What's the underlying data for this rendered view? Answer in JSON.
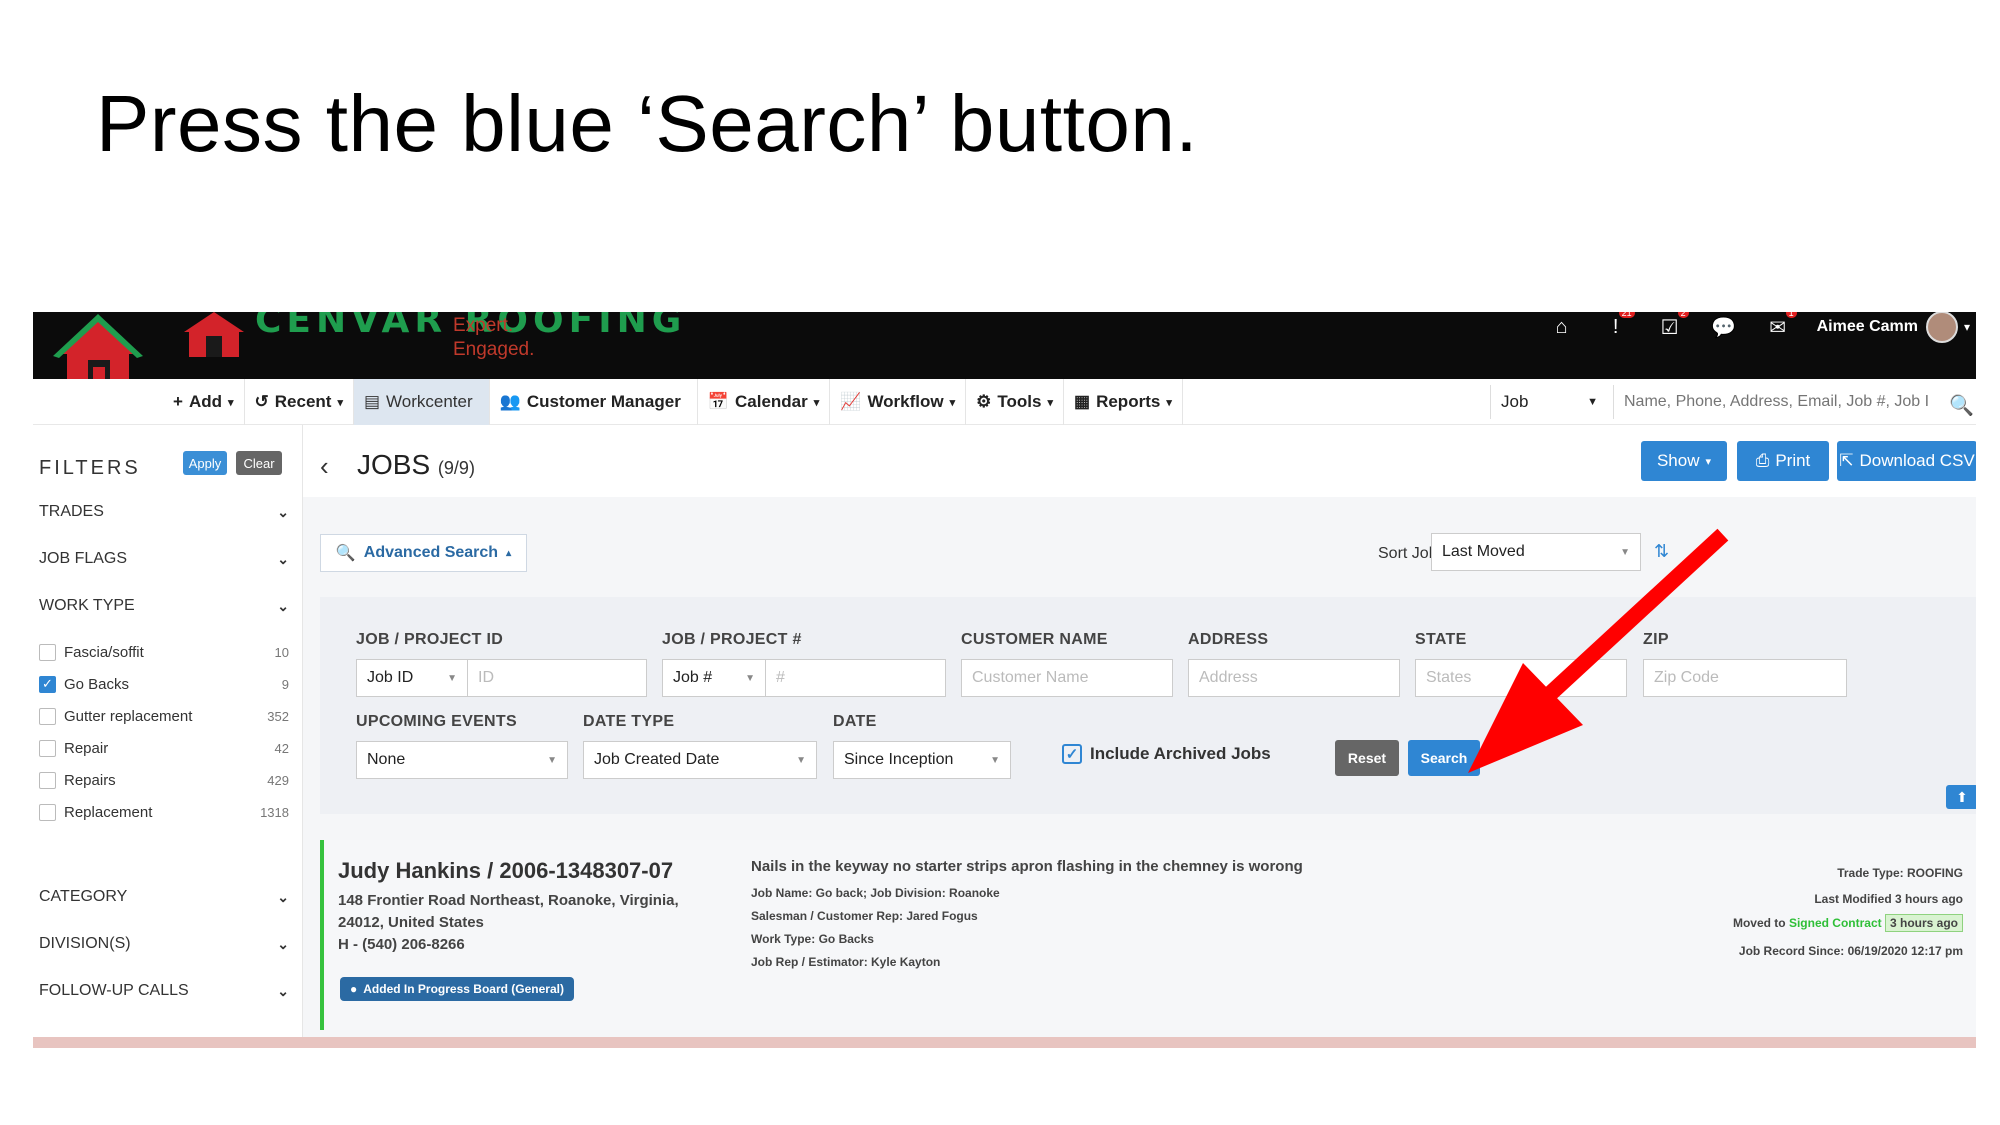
{
  "instruction": "Press the blue ‘Search’ button.",
  "logo": {
    "text": "CENVAR ROOFING",
    "tagline_1": "Expert.",
    "tagline_2": "Engaged."
  },
  "topbar": {
    "badges": {
      "alerts": "21",
      "tasks": "2",
      "mail": "1"
    },
    "user_name": "Aimee Camm"
  },
  "nav": {
    "items": [
      {
        "icon": "+",
        "label": "Add",
        "caret": "▾"
      },
      {
        "icon": "↺",
        "label": "Recent",
        "caret": "▾"
      },
      {
        "icon": "▤",
        "label": "Workcenter",
        "caret": ""
      },
      {
        "icon": "👥",
        "label": "Customer Manager",
        "caret": ""
      },
      {
        "icon": "📅",
        "label": "Calendar",
        "caret": "▾"
      },
      {
        "icon": "📈",
        "label": "Workflow",
        "caret": "▾"
      },
      {
        "icon": "⚙",
        "label": "Tools",
        "caret": "▾"
      },
      {
        "icon": "▦",
        "label": "Reports",
        "caret": "▾"
      }
    ],
    "search_type": "Job",
    "search_placeholder": "Name, Phone, Address, Email, Job #, Job I"
  },
  "filters": {
    "title": "FILTERS",
    "apply": "Apply",
    "clear": "Clear",
    "sections_top": [
      "TRADES",
      "JOB FLAGS",
      "WORK TYPE"
    ],
    "work_types": [
      {
        "label": "Fascia/soffit",
        "count": "10",
        "checked": false
      },
      {
        "label": "Go Backs",
        "count": "9",
        "checked": true
      },
      {
        "label": "Gutter replacement",
        "count": "352",
        "checked": false
      },
      {
        "label": "Repair",
        "count": "42",
        "checked": false
      },
      {
        "label": "Repairs",
        "count": "429",
        "checked": false
      },
      {
        "label": "Replacement",
        "count": "1318",
        "checked": false
      }
    ],
    "sections_bottom": [
      "CATEGORY",
      "DIVISION(S)",
      "FOLLOW-UP CALLS"
    ]
  },
  "jobs_header": {
    "title": "JOBS",
    "count": "(9/9)",
    "show": "Show",
    "print": "Print",
    "download": "Download CSV"
  },
  "advanced_search": {
    "toggle_label": "Advanced Search",
    "sort_label": "Sort Jobs By:",
    "sort_value": "Last Moved",
    "labels": {
      "job_project_id": "JOB / PROJECT ID",
      "job_project_num": "JOB / PROJECT #",
      "customer_name": "CUSTOMER NAME",
      "address": "ADDRESS",
      "state": "STATE",
      "zip": "ZIP",
      "upcoming_events": "UPCOMING EVENTS",
      "date_type": "DATE TYPE",
      "date": "DATE"
    },
    "values": {
      "id_type": "Job ID",
      "id_placeholder": "ID",
      "num_type": "Job #",
      "num_placeholder": "#",
      "customer_placeholder": "Customer Name",
      "address_placeholder": "Address",
      "state_placeholder": "States",
      "zip_placeholder": "Zip Code",
      "upcoming_events": "None",
      "date_type": "Job Created Date",
      "date": "Since Inception"
    },
    "include_archived": "Include Archived Jobs",
    "reset": "Reset",
    "search": "Search"
  },
  "job": {
    "title": "Judy Hankins / 2006-1348307-07",
    "address_1": "148 Frontier Road Northeast, Roanoke, Virginia,",
    "address_2": "24012, United States",
    "phone": "H - (540) 206-8266",
    "tag": "Added In Progress Board (General)",
    "description": "Nails in the keyway no starter strips apron flashing in the chemney is worong",
    "meta": [
      "Job Name:   Go back;   Job Division:   Roanoke",
      "Salesman / Customer Rep:   Jared Fogus",
      "Work Type:   Go Backs",
      "Job Rep / Estimator:   Kyle Kayton"
    ],
    "trade_type": "Trade Type: ROOFING",
    "last_modified": "Last Modified 3 hours ago",
    "moved_to_prefix": "Moved to",
    "moved_to_status": "Signed Contract",
    "moved_to_time": "3 hours ago",
    "record_since": "Job Record Since: 06/19/2020 12:17 pm"
  },
  "colors": {
    "accent_blue": "#2f86d3",
    "arrow_red": "#ff0000",
    "green": "#36c23e"
  }
}
